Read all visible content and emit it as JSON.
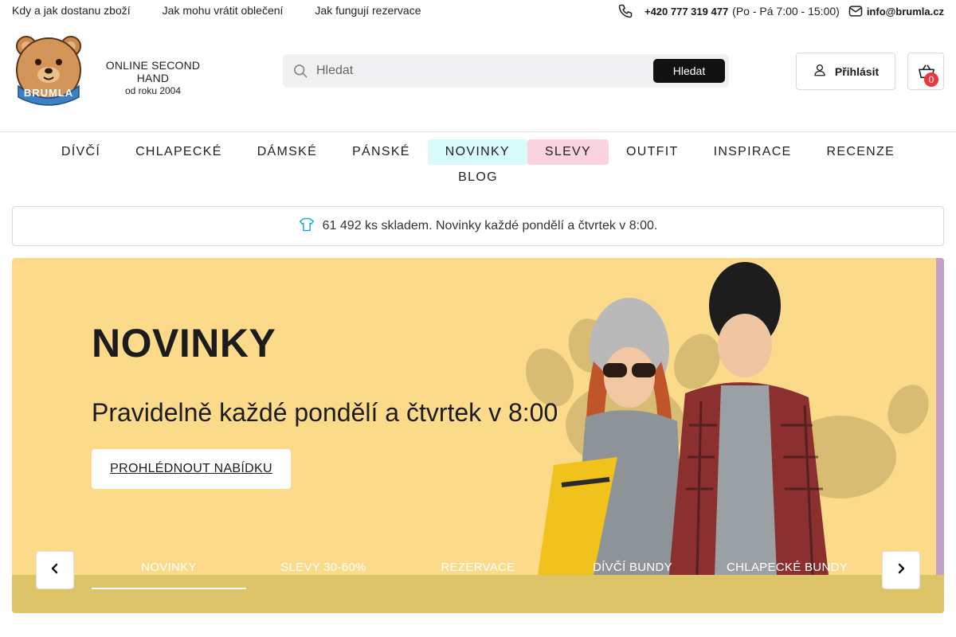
{
  "topbar": {
    "links": [
      "Kdy a jak dostanu zboží",
      "Jak mohu vrátit oblečení",
      "Jak fungují rezervace"
    ],
    "phone": "+420 777 319 477",
    "hours": "(Po - Pá 7:00 - 15:00)",
    "email": "info@brumla.cz"
  },
  "logo": {
    "brand": "BRUMLA",
    "tagline": "ONLINE SECOND HAND",
    "since": "od roku 2004"
  },
  "search": {
    "placeholder": "Hledat",
    "button_label": "Hledat"
  },
  "account": {
    "login_label": "Přihlásit",
    "cart_count": "0"
  },
  "nav": {
    "items": [
      "DÍVČÍ",
      "CHLAPECKÉ",
      "DÁMSKÉ",
      "PÁNSKÉ",
      "NOVINKY",
      "SLEVY",
      "OUTFIT",
      "INSPIRACE",
      "RECENZE",
      "BLOG"
    ],
    "highlight_colors": {
      "novinky": "#d9fbfb",
      "slevy": "#fbd3e0"
    }
  },
  "stock": {
    "text": "61 492 ks skladem. Novinky každé pondělí a čtvrtek v 8:00.",
    "icon": "tshirt-icon",
    "icon_color": "#2aa8c9"
  },
  "hero": {
    "title": "NOVINKY",
    "subtitle": "Pravidelně každé pondělí a čtvrtek v 8:00",
    "cta_label": "PROHLÉDNOUT NABÍDKU",
    "background_color": "#fbdb8a",
    "slides": [
      "NOVINKY",
      "SLEVY 30-60%",
      "REZERVACE",
      "DÍVČÍ BUNDY",
      "CHLAPECKÉ BUNDY"
    ],
    "active_slide": 0
  }
}
